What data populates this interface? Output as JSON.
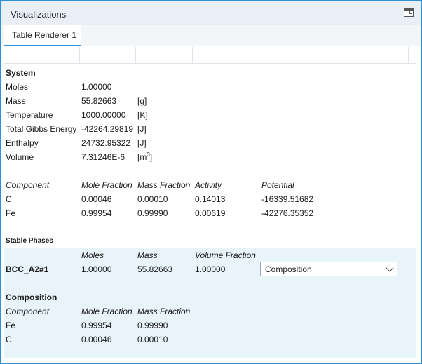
{
  "window": {
    "title": "Visualizations"
  },
  "tabs": [
    {
      "label": "Table Renderer 1"
    }
  ],
  "system": {
    "heading": "System",
    "rows": [
      {
        "label": "Moles",
        "value": "1.00000",
        "unit": ""
      },
      {
        "label": "Mass",
        "value": "55.82663",
        "unit": "[g]"
      },
      {
        "label": "Temperature",
        "value": "1000.00000",
        "unit": "[K]"
      },
      {
        "label": "Total Gibbs Energy",
        "value": "-42264.29819",
        "unit": "[J]"
      },
      {
        "label": "Enthalpy",
        "value": "24732.95322",
        "unit": "[J]"
      },
      {
        "label": "Volume",
        "value": "7.31246E-6",
        "unit_base": "[m",
        "unit_sup": "3",
        "unit_end": "]"
      }
    ]
  },
  "components": {
    "headers": [
      "Component",
      "Mole Fraction",
      "Mass Fraction",
      "Activity",
      "Potential"
    ],
    "rows": [
      [
        "C",
        "0.00046",
        "0.00010",
        "0.14013",
        "-16339.51682"
      ],
      [
        "Fe",
        "0.99954",
        "0.99990",
        "0.00619",
        "-42276.35352"
      ]
    ]
  },
  "stable_phases": {
    "heading": "Stable Phases",
    "headers": [
      "Moles",
      "Mass",
      "Volume Fraction"
    ],
    "phase": {
      "name": "BCC_A2#1",
      "moles": "1.00000",
      "mass": "55.82663",
      "volume_fraction": "1.00000"
    },
    "dropdown": {
      "selected": "Composition"
    }
  },
  "composition": {
    "heading": "Composition",
    "headers": [
      "Component",
      "Mole Fraction",
      "Mass Fraction"
    ],
    "rows": [
      [
        "Fe",
        "0.99954",
        "0.99990"
      ],
      [
        "C",
        "0.00046",
        "0.00010"
      ]
    ]
  },
  "colors": {
    "accent": "#2f8fd8",
    "titlebar": "#e9eff6",
    "phase_panel": "#e8f3fa"
  }
}
